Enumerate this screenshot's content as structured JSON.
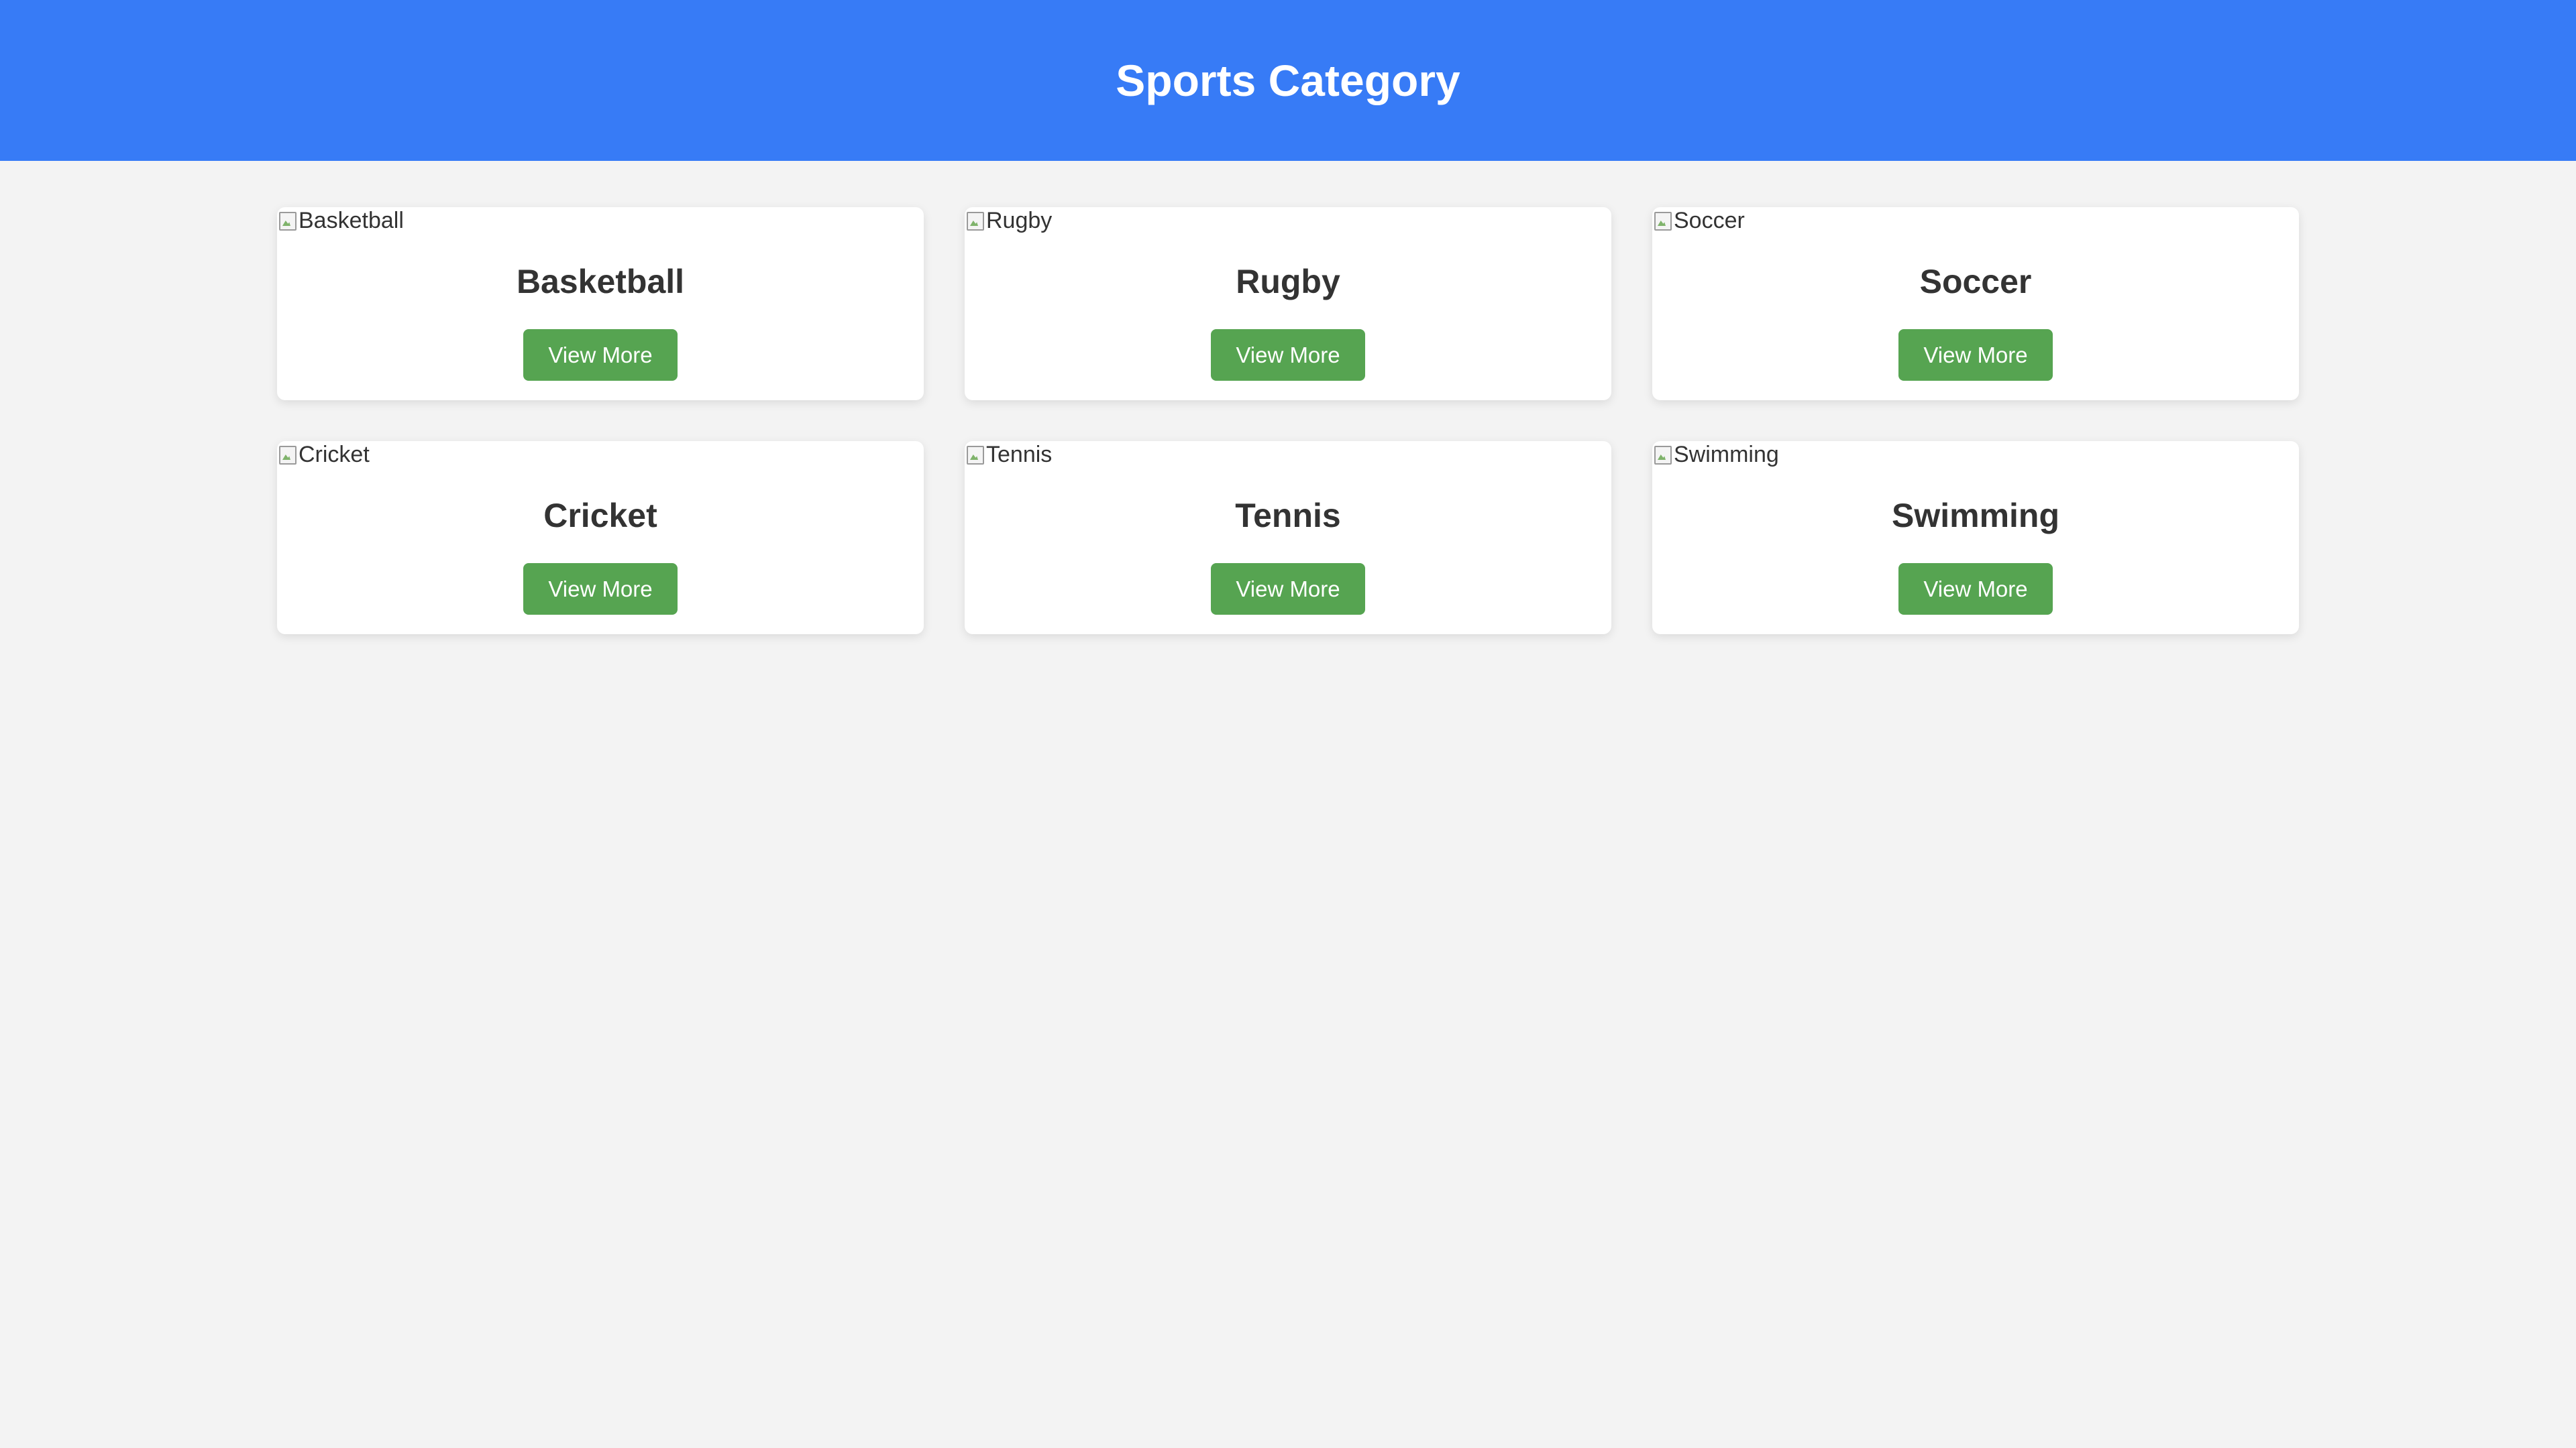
{
  "header": {
    "title": "Sports Category"
  },
  "cards": [
    {
      "image_alt": "Basketball",
      "title": "Basketball",
      "button_label": "View More"
    },
    {
      "image_alt": "Rugby",
      "title": "Rugby",
      "button_label": "View More"
    },
    {
      "image_alt": "Soccer",
      "title": "Soccer",
      "button_label": "View More"
    },
    {
      "image_alt": "Cricket",
      "title": "Cricket",
      "button_label": "View More"
    },
    {
      "image_alt": "Tennis",
      "title": "Tennis",
      "button_label": "View More"
    },
    {
      "image_alt": "Swimming",
      "title": "Swimming",
      "button_label": "View More"
    }
  ],
  "colors": {
    "header_bg": "#377bf6",
    "page_bg": "#f3f3f3",
    "button_bg": "#56a451",
    "card_bg": "#ffffff",
    "text": "#333333"
  },
  "icons": {
    "broken_image": "broken-image-icon"
  }
}
